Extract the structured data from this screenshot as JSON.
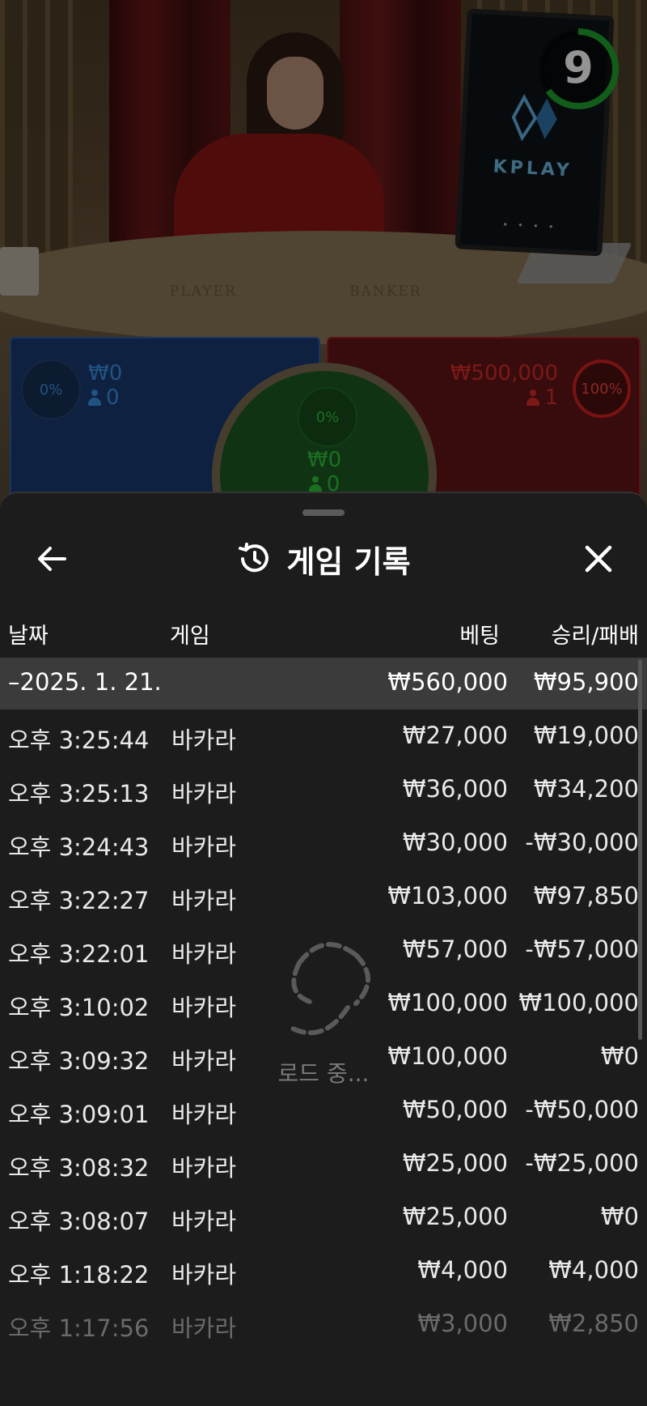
{
  "video": {
    "table_labels": [
      "PLAYER",
      "BANKER"
    ],
    "monitor_brand": "KPLAY",
    "monitor_dots": "• • • •",
    "countdown": "9"
  },
  "bets": {
    "player": {
      "percent": "0%",
      "amount": "₩0",
      "players": "0",
      "color": "#3a8fe0"
    },
    "tie": {
      "percent": "0%",
      "amount": "₩0",
      "players": "0",
      "color": "#2fc03a"
    },
    "banker": {
      "percent": "100%",
      "amount": "₩500,000",
      "players": "1",
      "color": "#d82a2a"
    }
  },
  "sheet": {
    "title": "게임 기록",
    "back_icon": "arrow-left-icon",
    "history_icon": "history-icon",
    "close_icon": "close-icon",
    "columns": {
      "date": "날짜",
      "game": "게임",
      "bet": "베팅",
      "win_loss": "승리/패배"
    },
    "summary": {
      "date": "–2025. 1. 21.",
      "bet": "₩560,000",
      "win_loss": "₩95,900"
    },
    "rows": [
      {
        "time": "오후 3:25:44",
        "game": "바카라",
        "bet": "₩27,000",
        "win_loss": "₩19,000"
      },
      {
        "time": "오후 3:25:13",
        "game": "바카라",
        "bet": "₩36,000",
        "win_loss": "₩34,200"
      },
      {
        "time": "오후 3:24:43",
        "game": "바카라",
        "bet": "₩30,000",
        "win_loss": "-₩30,000"
      },
      {
        "time": "오후 3:22:27",
        "game": "바카라",
        "bet": "₩103,000",
        "win_loss": "₩97,850"
      },
      {
        "time": "오후 3:22:01",
        "game": "바카라",
        "bet": "₩57,000",
        "win_loss": "-₩57,000"
      },
      {
        "time": "오후 3:10:02",
        "game": "바카라",
        "bet": "₩100,000",
        "win_loss": "₩100,000"
      },
      {
        "time": "오후 3:09:32",
        "game": "바카라",
        "bet": "₩100,000",
        "win_loss": "₩0"
      },
      {
        "time": "오후 3:09:01",
        "game": "바카라",
        "bet": "₩50,000",
        "win_loss": "-₩50,000"
      },
      {
        "time": "오후 3:08:32",
        "game": "바카라",
        "bet": "₩25,000",
        "win_loss": "-₩25,000"
      },
      {
        "time": "오후 3:08:07",
        "game": "바카라",
        "bet": "₩25,000",
        "win_loss": "₩0"
      },
      {
        "time": "오후 1:18:22",
        "game": "바카라",
        "bet": "₩4,000",
        "win_loss": "₩4,000"
      },
      {
        "time": "오후 1:17:56",
        "game": "바카라",
        "bet": "₩3,000",
        "win_loss": "₩2,850"
      }
    ],
    "loading_text": "로드 중..."
  }
}
